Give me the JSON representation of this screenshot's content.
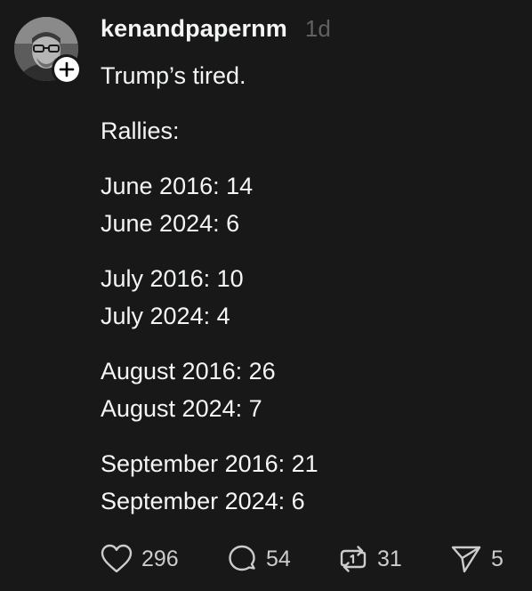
{
  "post": {
    "username": "kenandpapernm",
    "timestamp": "1d",
    "lines": [
      "Trump’s tired.",
      "",
      "Rallies:",
      "",
      "June 2016: 14",
      "June 2024: 6",
      "",
      "July 2016: 10",
      "July 2024: 4",
      "",
      "August 2016: 26",
      "August 2024: 7",
      "",
      "September 2016: 21",
      "September 2024: 6"
    ]
  },
  "actions": {
    "likes": "296",
    "replies": "54",
    "reposts": "31",
    "shares": "5"
  },
  "icons": {
    "like": "heart-icon",
    "reply": "speech-bubble-icon",
    "repost": "repost-arrows-icon",
    "share": "paper-plane-icon",
    "follow": "plus-icon"
  },
  "colors": {
    "background": "#181818",
    "text": "#f3f5f7",
    "muted": "#616161",
    "icon": "#cccccc"
  }
}
